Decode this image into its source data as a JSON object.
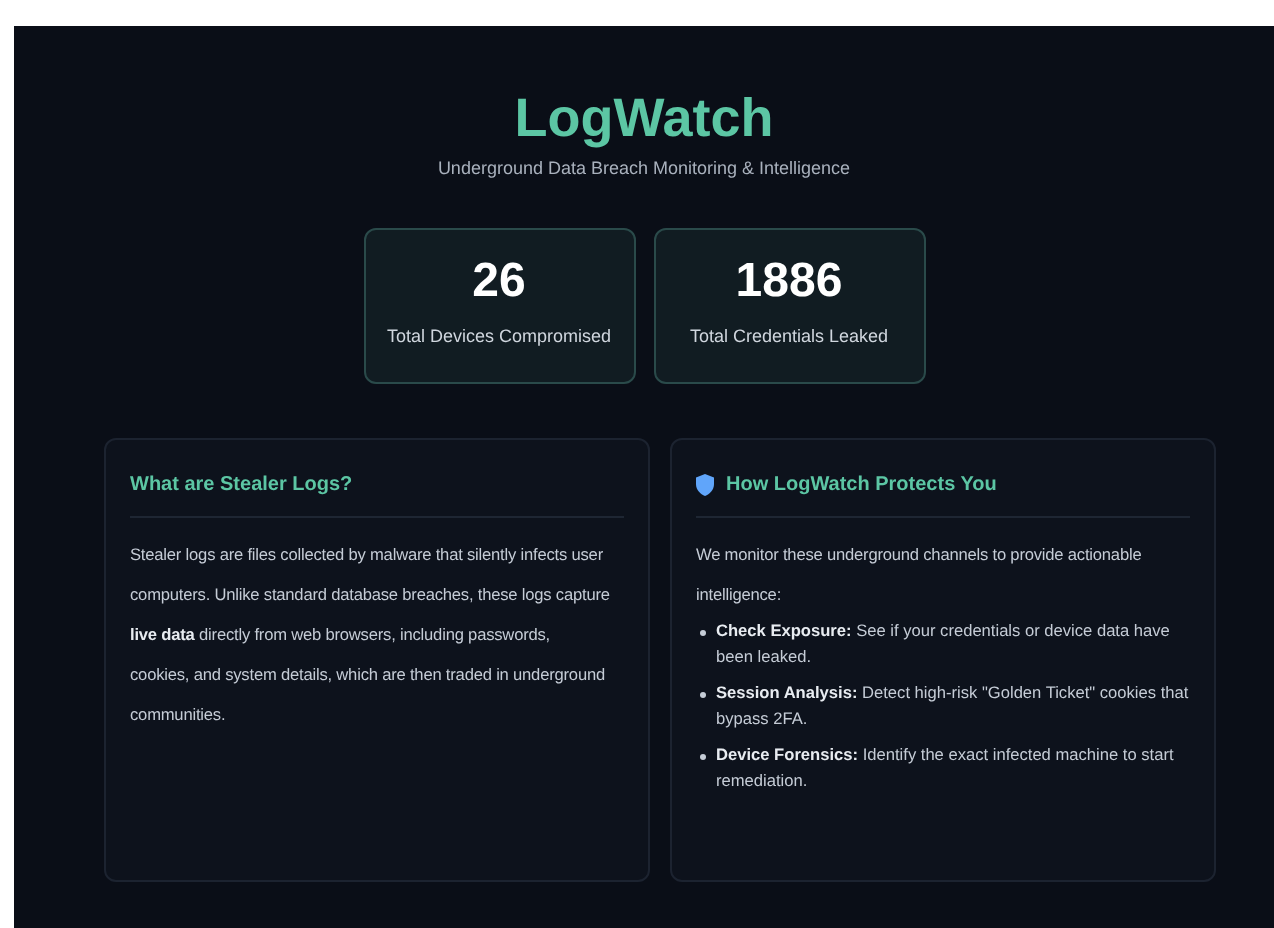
{
  "header": {
    "title": "LogWatch",
    "subtitle": "Underground Data Breach Monitoring & Intelligence"
  },
  "stats": [
    {
      "value": "26",
      "label": "Total Devices Compromised"
    },
    {
      "value": "1886",
      "label": "Total Credentials Leaked"
    }
  ],
  "panels": [
    {
      "title": "What are Stealer Logs?",
      "kind": "text",
      "paragraph": "Stealer logs are files collected by malware that silently infects user computers. Unlike standard database breaches, these logs capture **live data** directly from web browsers, including passwords, cookies, and system details, which are then traded in underground communities."
    },
    {
      "title": "How LogWatch Protects You",
      "kind": "list",
      "paragraph": "We monitor these underground channels to provide actionable intelligence:",
      "bullets": [
        "**Check Exposure:** See if your credentials or device data have been leaked.",
        "**Session Analysis:** Detect high-risk \"Golden Ticket\" cookies that bypass 2FA.",
        "**Device Forensics:** Identify the exact infected machine to start remediation."
      ]
    }
  ]
}
